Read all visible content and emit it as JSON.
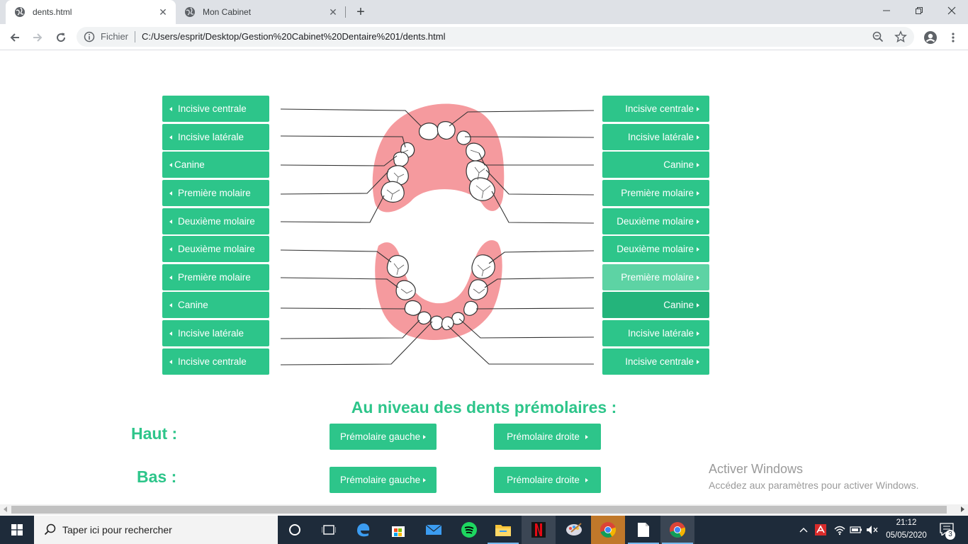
{
  "browser": {
    "tabs": [
      {
        "title": "dents.html",
        "active": true
      },
      {
        "title": "Mon Cabinet",
        "active": false
      }
    ],
    "omnibox": {
      "scheme_label": "Fichier",
      "url": "C:/Users/esprit/Desktop/Gestion%20Cabinet%20Dentaire%201/dents.html"
    }
  },
  "teeth": {
    "left": [
      {
        "label": "Incisive centrale"
      },
      {
        "label": "Incisive latérale"
      },
      {
        "label": "Canine"
      },
      {
        "label": "Première molaire"
      },
      {
        "label": "Deuxième molaire"
      },
      {
        "label": "Deuxième molaire"
      },
      {
        "label": "Première molaire"
      },
      {
        "label": "Canine"
      },
      {
        "label": "Incisive latérale"
      },
      {
        "label": "Incisive centrale"
      }
    ],
    "right": [
      {
        "label": "Incisive centrale"
      },
      {
        "label": "Incisive latérale"
      },
      {
        "label": "Canine"
      },
      {
        "label": "Première molaire"
      },
      {
        "label": "Deuxième molaire"
      },
      {
        "label": "Deuxième molaire"
      },
      {
        "label": "Première molaire"
      },
      {
        "label": "Canine"
      },
      {
        "label": "Incisive latérale"
      },
      {
        "label": "Incisive centrale"
      }
    ]
  },
  "premolars": {
    "title": "Au niveau des dents prémolaires :",
    "haut_label": "Haut :",
    "bas_label": "Bas :",
    "left_button": "Prémolaire gauche",
    "right_button": "Prémolaire droite"
  },
  "watermark": {
    "title": "Activer Windows",
    "subtitle": "Accédez aux paramètres pour activer Windows."
  },
  "taskbar": {
    "search_placeholder": "Taper ici pour rechercher",
    "time": "21:12",
    "date": "05/05/2020",
    "notifications": "3"
  },
  "colors": {
    "accent": "#2dc58a",
    "gum": "#f59a9e",
    "taskbar": "#1e2b3a"
  }
}
